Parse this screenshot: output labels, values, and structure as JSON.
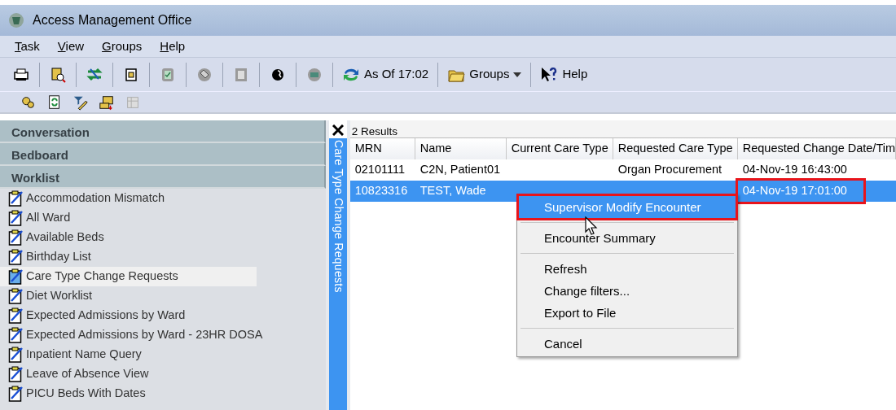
{
  "window": {
    "title": "Access Management Office"
  },
  "menu": [
    {
      "label": "Task"
    },
    {
      "label": "View"
    },
    {
      "label": "Groups"
    },
    {
      "label": "Help"
    }
  ],
  "toolbar": {
    "buttons": [
      {
        "label": "As Of 17:02",
        "dropdown": false
      },
      {
        "label": "Groups",
        "dropdown": true
      },
      {
        "label": "Help",
        "dropdown": false
      }
    ]
  },
  "sidebar": {
    "sections": [
      {
        "label": "Conversation"
      },
      {
        "label": "Bedboard"
      },
      {
        "label": "Worklist"
      }
    ],
    "items": [
      {
        "label": "Accommodation Mismatch",
        "selected": false
      },
      {
        "label": "All Ward",
        "selected": false
      },
      {
        "label": "Available Beds",
        "selected": false
      },
      {
        "label": "Birthday List",
        "selected": false
      },
      {
        "label": "Care Type Change Requests",
        "selected": true
      },
      {
        "label": "Diet Worklist",
        "selected": false
      },
      {
        "label": "Expected Admissions by Ward",
        "selected": false
      },
      {
        "label": "Expected Admissions by Ward - 23HR DOSA",
        "selected": false
      },
      {
        "label": "Inpatient Name Query",
        "selected": false
      },
      {
        "label": "Leave of Absence View",
        "selected": false
      },
      {
        "label": "PICU Beds With Dates",
        "selected": false
      }
    ]
  },
  "vertical_tab": {
    "label": "Care Type Change Requests"
  },
  "results": {
    "count": "2 Results",
    "columns": [
      "MRN",
      "Name",
      "Current Care Type",
      "Requested Care Type",
      "Requested Change Date/Tim"
    ],
    "rows": [
      {
        "selected": false,
        "mrn": "02101111",
        "name": "C2N, Patient01",
        "requested_care_type": "Organ Procurement",
        "requested_change_date": "04-Nov-19 16:43:00",
        "date_highlighted": false
      },
      {
        "selected": true,
        "mrn": "10823316",
        "name": "TEST, Wade",
        "requested_change_date": "04-Nov-19 17:01:00",
        "date_highlighted": true
      }
    ]
  },
  "context_menu": [
    {
      "kind": "item",
      "label": "Supervisor Modify Encounter",
      "selected": true,
      "highlighted": true
    },
    {
      "kind": "separator"
    },
    {
      "kind": "item",
      "label": "Encounter Summary",
      "selected": false,
      "highlighted": false
    },
    {
      "kind": "separator"
    },
    {
      "kind": "item",
      "label": "Refresh",
      "selected": false,
      "highlighted": false
    },
    {
      "kind": "item",
      "label": "Change filters...",
      "selected": false,
      "highlighted": false
    },
    {
      "kind": "item",
      "label": "Export to File",
      "selected": false,
      "highlighted": false
    },
    {
      "kind": "separator"
    },
    {
      "kind": "item",
      "label": "Cancel",
      "selected": false,
      "highlighted": false
    }
  ]
}
